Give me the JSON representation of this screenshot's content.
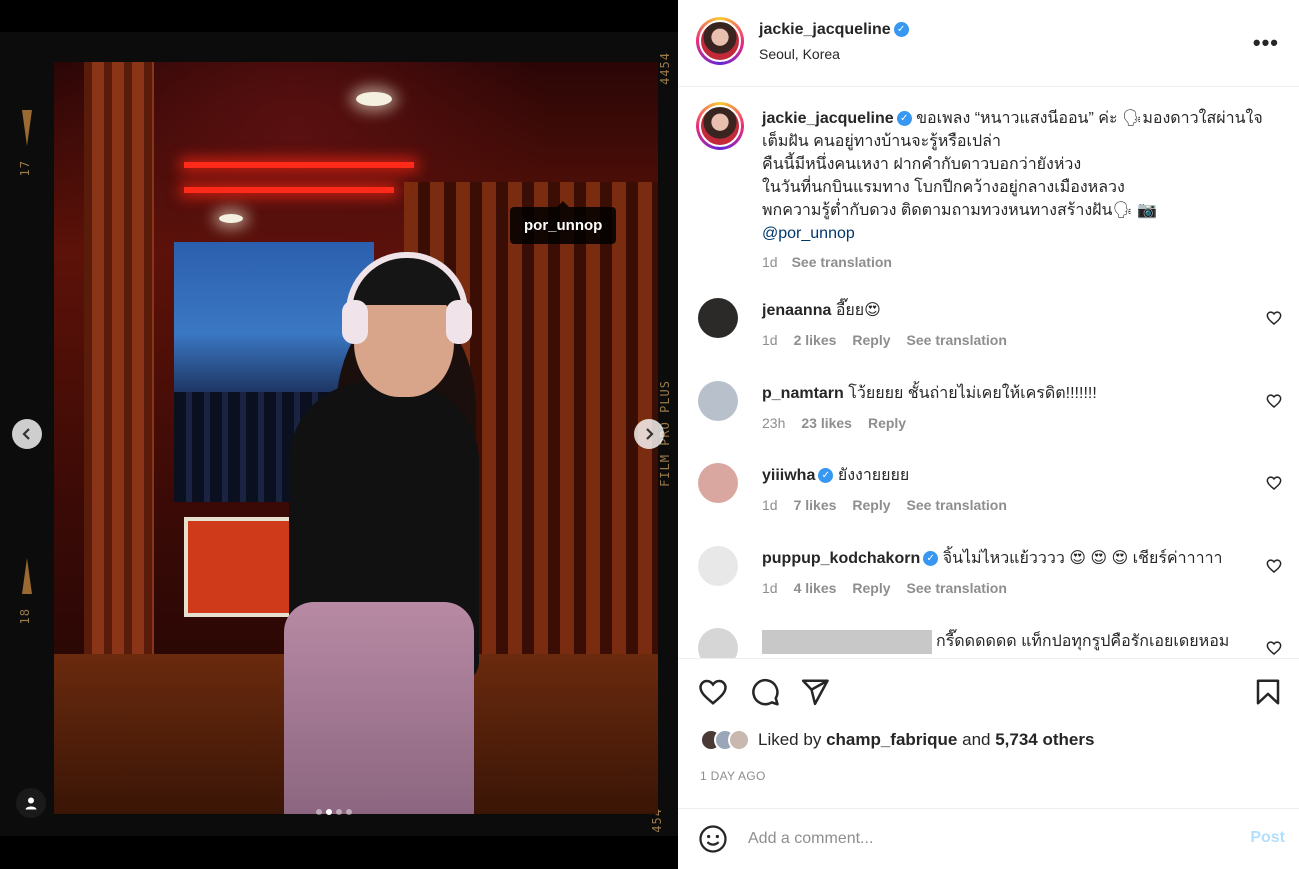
{
  "post": {
    "username": "jackie_jacqueline",
    "verified": true,
    "location": "Seoul, Korea",
    "more_icon": "more-horizontal-icon"
  },
  "media": {
    "tag_label": "por_unnop",
    "film_marks": {
      "top_number": "4454",
      "left_top": "17",
      "left_bottom": "18",
      "right_brand": "FILM PRO PLUS",
      "bottom_number": "454"
    },
    "carousel": {
      "total": 4,
      "active_index": 1
    },
    "icons": {
      "prev": "chevron-left-icon",
      "next": "chevron-right-icon",
      "tagged": "user-icon"
    }
  },
  "caption": {
    "username": "jackie_jacqueline",
    "text": "ขอเพลง “หนาวแสงนีออน” ค่ะ 🗣มองดาวใสผ่านใจเต็มฝัน คนอยู่ทางบ้านจะรู้หรือเปล่า",
    "line2": "คืนนี้มีหนึ่งคนเหงา ฝากคำกับดาวบอกว่ายังห่วง",
    "line3": "ในวันที่นกบินแรมทาง โบกปีกคว้างอยู่กลางเมืองหลวง",
    "line4": "พกความรู้ต่ำกับดวง ติดตามถามทวงหนทางสร้างฝัน🗣 📷",
    "mention": "@por_unnop",
    "time": "1d",
    "see_translation": "See translation"
  },
  "comments": [
    {
      "username": "jenaanna",
      "verified": false,
      "text": "อี๊ยย😍",
      "time": "1d",
      "likes": "2 likes",
      "reply": "Reply",
      "translate": "See translation"
    },
    {
      "username": "p_namtarn",
      "verified": false,
      "text": "โว้ยยยย ชั้นถ่ายไม่เคยให้เครดิต!!!!!!!",
      "time": "23h",
      "likes": "23 likes",
      "reply": "Reply",
      "translate": ""
    },
    {
      "username": "yiiiwha",
      "verified": true,
      "text": "ยังงายยยย",
      "time": "1d",
      "likes": "7 likes",
      "reply": "Reply",
      "translate": "See translation"
    },
    {
      "username": "puppup_kodchakorn",
      "verified": true,
      "text": "จิ้นไม่ไหวแย้วววว 😍 😍 😍 เชียร์ค่าาาาา",
      "time": "1d",
      "likes": "4 likes",
      "reply": "Reply",
      "translate": "See translation"
    },
    {
      "username": "",
      "verified": false,
      "text": "กรี๊ดดดดดด แท็กปอทุกรูปคือรักเอยเดยหอม",
      "time": "",
      "likes": "",
      "reply": "",
      "translate": ""
    }
  ],
  "actions": {
    "like_icon": "heart-icon",
    "comment_icon": "comment-icon",
    "share_icon": "send-icon",
    "save_icon": "bookmark-icon",
    "liked_by_prefix": "Liked by",
    "liked_by_user": "champ_fabrique",
    "and": "and",
    "others": "5,734 others",
    "date": "1 DAY AGO"
  },
  "add_comment": {
    "placeholder": "Add a comment...",
    "post_label": "Post",
    "emoji_icon": "smiley-icon"
  },
  "colors": {
    "accent": "#0095f6",
    "post_disabled": "#b2dffc",
    "verified": "#3897f0",
    "muted": "#8e8e8e",
    "mention": "#00376b"
  }
}
